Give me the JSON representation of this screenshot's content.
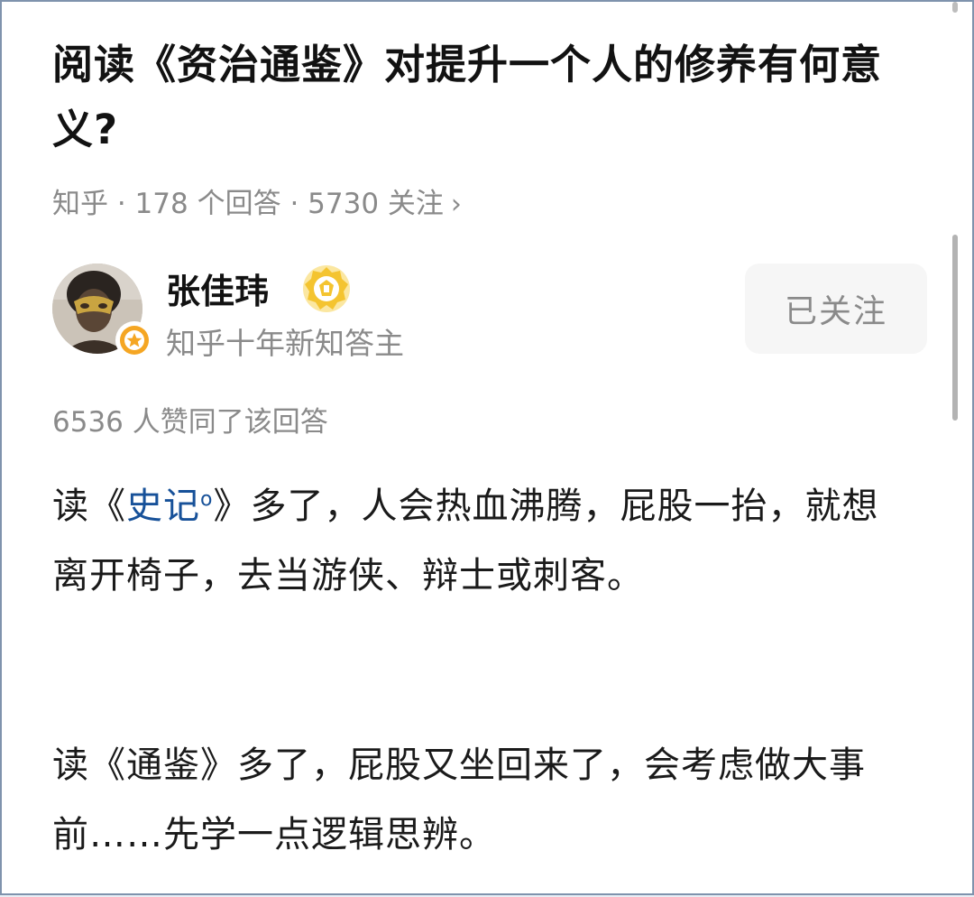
{
  "question": {
    "title": "阅读《资治通鉴》对提升一个人的修养有何意义?",
    "meta": "知乎 · 178 个回答 · 5730 关注",
    "chevron": "›"
  },
  "author": {
    "name": "张佳玮",
    "subtitle": "知乎十年新知答主",
    "follow_label": "已关注",
    "avatar_icon": "masked-person-avatar",
    "badge_icon": "gold-medal-icon"
  },
  "answer": {
    "votes": "6536 人赞同了该回答",
    "p1_a": "读《",
    "p1_link": "史记",
    "p1_link_marker": "ο",
    "p1_b": "》多了，人会热血沸腾，屁股一抬，就想离开椅子，去当游侠、辩士或刺客。",
    "p2": "读《通鉴》多了，屁股又坐回来了，会考虑做大事前……先学一点逻辑思辨。"
  },
  "colors": {
    "link": "#175199",
    "muted": "#8a8a8a",
    "badge_orange": "#f5a623",
    "medal_gold": "#f4c430"
  }
}
